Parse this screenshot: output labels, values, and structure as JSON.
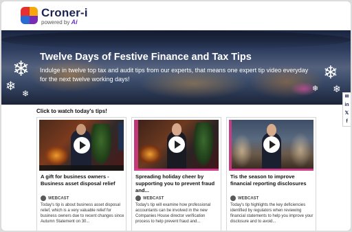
{
  "brand": {
    "name": "Croner-i",
    "powered_prefix": "powered by",
    "powered_logo": "Ai",
    "logo_colors": [
      "#e6302f",
      "#f7a70b",
      "#2a6bd1",
      "#7b2ab8"
    ]
  },
  "hero": {
    "title": "Twelve Days of Festive Finance and Tax Tips",
    "subtitle": "Indulge in twelve top tax and audit tips from our experts, that means one expert tip video everyday for the next twelve working days!"
  },
  "share": [
    "mail-icon",
    "linkedin-icon",
    "x-icon",
    "facebook-icon"
  ],
  "share_glyphs": [
    "✉",
    "in",
    "𝕏",
    "f"
  ],
  "section_title": "Click to watch today's tips!",
  "cards": [
    {
      "title": "A gift for business owners - Business asset disposal relief",
      "type": "WEBCAST",
      "description": "Today's tip is about business asset disposal relief, which is a very valuable relief for business owners due to recent changes since Autumn Statement on 30..."
    },
    {
      "title": "Spreading holiday cheer by supporting you to prevent fraud and...",
      "type": "WEBCAST",
      "description": "Today's tip will examine how professional accountants can be involved in the new Companies House director verification process to help prevent fraud and..."
    },
    {
      "title": "Tis the season to improve financial reporting disclosures",
      "type": "WEBCAST",
      "description": "Today's tip highlights the key deficiencies identified by regulators when reviewing financial statements to help you improve your disclosure and to avoid..."
    }
  ]
}
